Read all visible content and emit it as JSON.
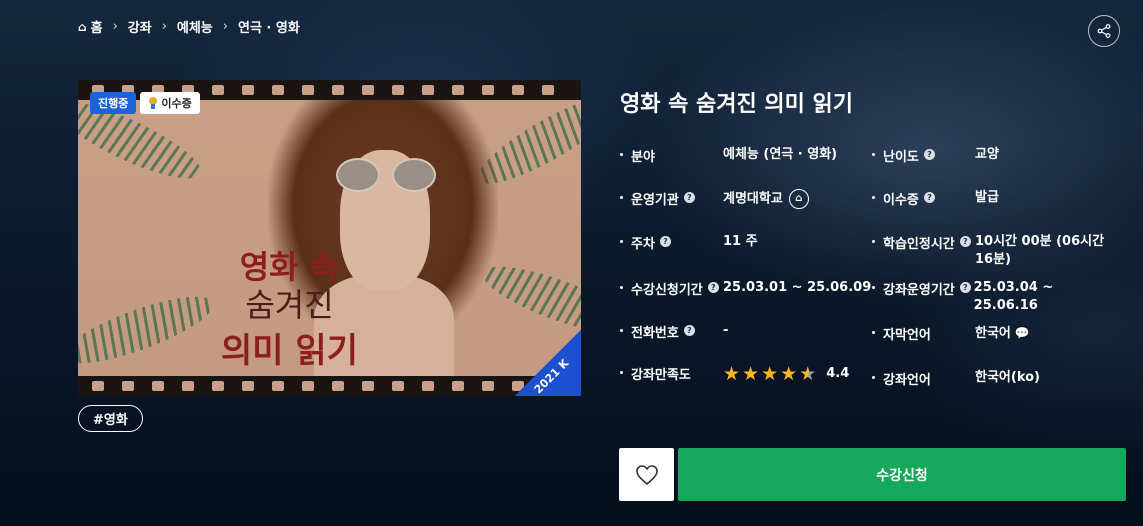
{
  "breadcrumb": {
    "items": [
      "홈",
      "강좌",
      "예체능",
      "연극 · 영화"
    ]
  },
  "course": {
    "title": "영화 속 숨겨진 의미 읽기",
    "thumbnail": {
      "title_line1": "영화 속",
      "title_line2": "숨겨진",
      "title_line3": "의미 읽기",
      "corner_text": "2021 K"
    },
    "badges": {
      "status": "진행중",
      "certificate": "이수증"
    },
    "tag": "#영화"
  },
  "info": {
    "field_label": "분야",
    "field_value": "예체능 (연극 · 영화)",
    "difficulty_label": "난이도",
    "difficulty_value": "교양",
    "institution_label": "운영기관",
    "institution_value": "계명대학교",
    "certificate_label": "이수증",
    "certificate_value": "발급",
    "weeks_label": "주차",
    "weeks_value": "11 주",
    "study_time_label": "학습인정시간",
    "study_time_value": "10시간 00분 (06시간 16분)",
    "enroll_period_label": "수강신청기간",
    "enroll_period_value": "25.03.01 ~ 25.06.09",
    "course_period_label": "강좌운영기간",
    "course_period_value": "25.03.04 ~ 25.06.16",
    "phone_label": "전화번호",
    "phone_value": "-",
    "subtitle_label": "자막언어",
    "subtitle_value": "한국어",
    "satisfaction_label": "강좌만족도",
    "satisfaction_value": "4.4",
    "satisfaction_rating": 4.4,
    "language_label": "강좌언어",
    "language_value": "한국어(ko)"
  },
  "actions": {
    "enroll_label": "수강신청"
  },
  "colors": {
    "enroll_button": "#14a85a",
    "status_badge": "#1d63d8",
    "star": "#f5b722"
  }
}
